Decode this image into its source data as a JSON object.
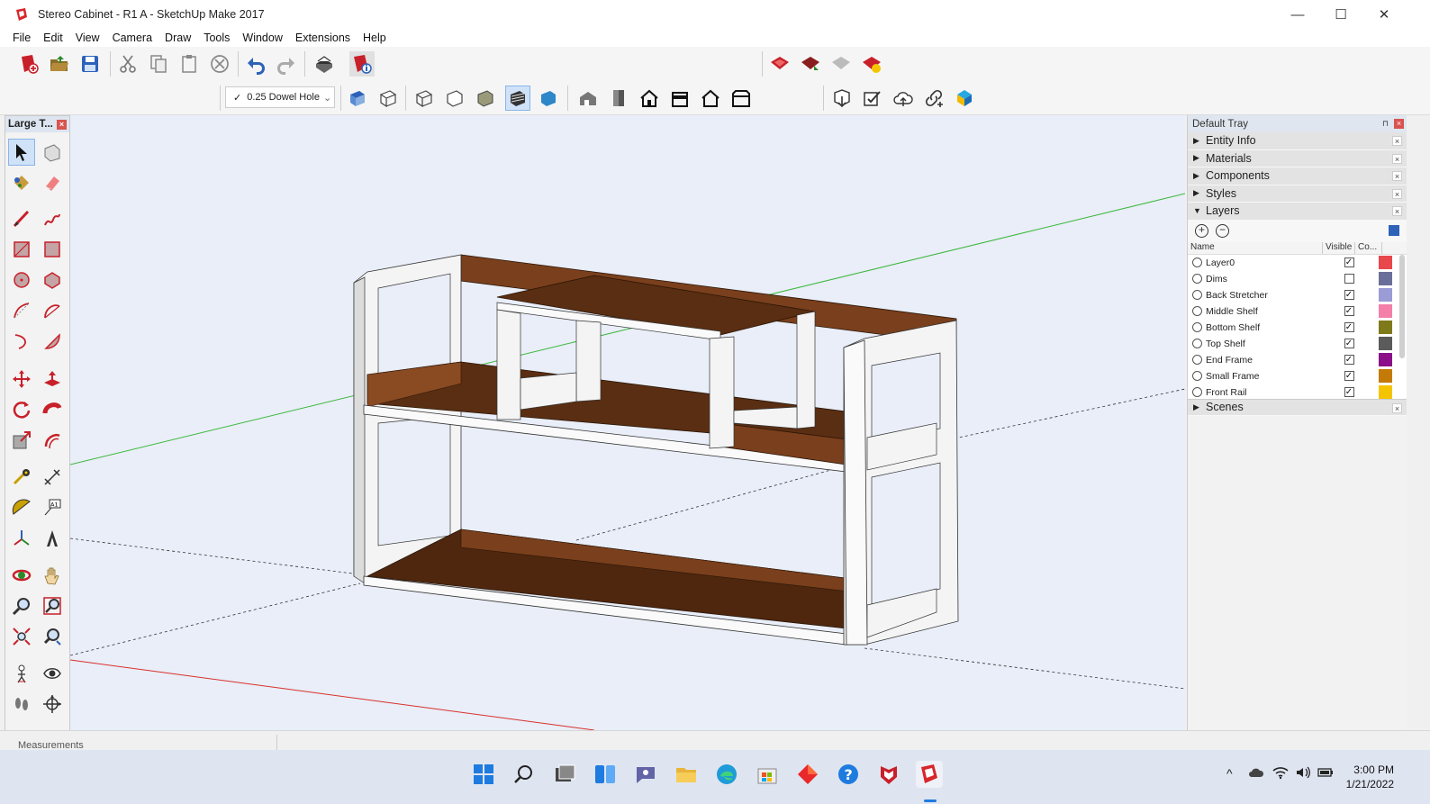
{
  "window": {
    "title": "Stereo Cabinet - R1 A - SketchUp Make 2017",
    "minimize": "—",
    "maximize": "☐",
    "close": "✕"
  },
  "menu": [
    "File",
    "Edit",
    "View",
    "Camera",
    "Draw",
    "Tools",
    "Window",
    "Extensions",
    "Help"
  ],
  "toolbar": {
    "dropdown_check": "✓",
    "dropdown_value": "0.25 Dowel Hole",
    "dropdown_caret": "⌄"
  },
  "tool_palette": {
    "title": "Large T...",
    "close": "×"
  },
  "tray": {
    "title": "Default Tray",
    "pin": "⊓",
    "close": "×",
    "panels": [
      {
        "label": "Entity Info",
        "expanded": false
      },
      {
        "label": "Materials",
        "expanded": false
      },
      {
        "label": "Components",
        "expanded": false
      },
      {
        "label": "Styles",
        "expanded": false
      },
      {
        "label": "Layers",
        "expanded": true
      }
    ],
    "scenes_label": "Scenes",
    "layers": {
      "columns": {
        "name": "Name",
        "visible": "Visible",
        "color": "Co..."
      },
      "rows": [
        {
          "name": "Layer0",
          "visible": true,
          "color": "#e8474b"
        },
        {
          "name": "Dims",
          "visible": false,
          "color": "#6a6f9a"
        },
        {
          "name": "Back Stretcher",
          "visible": true,
          "color": "#9b9bd6"
        },
        {
          "name": "Middle Shelf",
          "visible": true,
          "color": "#f47fa8"
        },
        {
          "name": "Bottom Shelf",
          "visible": true,
          "color": "#7e7a1a"
        },
        {
          "name": "Top Shelf",
          "visible": true,
          "color": "#5b5b5b"
        },
        {
          "name": "End Frame",
          "visible": true,
          "color": "#8b0f88"
        },
        {
          "name": "Small Frame",
          "visible": true,
          "color": "#c47a07"
        },
        {
          "name": "Front Rail",
          "visible": true,
          "color": "#f5c400"
        }
      ]
    }
  },
  "status": {
    "measurements_label": "Measurements"
  },
  "taskbar": {
    "time": "3:00 PM",
    "date": "1/21/2022",
    "chevron": "^"
  }
}
